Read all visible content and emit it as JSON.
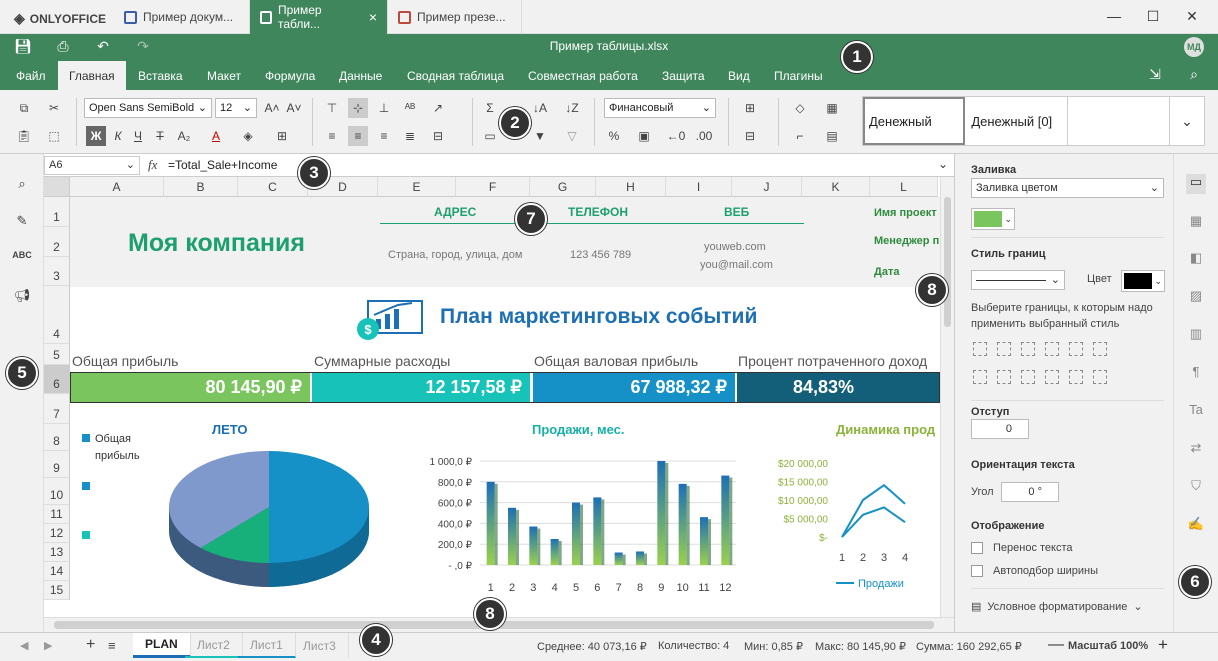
{
  "titlebar": {
    "logo": "ONLYOFFICE",
    "tabs": [
      {
        "label": "Пример докум...",
        "color": "#3a5da5"
      },
      {
        "label": "Пример табли...",
        "color": "#40865c"
      },
      {
        "label": "Пример презе...",
        "color": "#b94a3c"
      }
    ],
    "close_tab": "×",
    "minimize": "—",
    "maximize": "☐",
    "close": "✕"
  },
  "header": {
    "doc_title": "Пример таблицы.xlsx",
    "avatar": "МД",
    "menu": [
      "Файл",
      "Главная",
      "Вставка",
      "Макет",
      "Формула",
      "Данные",
      "Сводная таблица",
      "Совместная работа",
      "Защита",
      "Вид",
      "Плагины"
    ]
  },
  "toolbar": {
    "font_name": "Open Sans SemiBold",
    "font_size": "12",
    "number_format": "Финансовый",
    "styles": [
      "Денежный",
      "Денежный [0]",
      ""
    ]
  },
  "formula": {
    "cell_ref": "A6",
    "fx": "fx",
    "content": "=Total_Sale+Income"
  },
  "grid": {
    "columns": [
      "A",
      "B",
      "C",
      "D",
      "E",
      "F",
      "G",
      "H",
      "I",
      "J",
      "K",
      "L"
    ],
    "rows": [
      "1",
      "2",
      "3",
      "4",
      "5",
      "6",
      "7",
      "8",
      "9",
      "10",
      "11",
      "12",
      "13",
      "14",
      "15"
    ],
    "company": "Моя компания",
    "address_label": "АДРЕС",
    "phone_label": "ТЕЛЕФОН",
    "web_label": "ВЕБ",
    "address": "Страна, город, улица, дом",
    "phone": "123 456 789",
    "web1": "youweb.com",
    "web2": "you@mail.com",
    "project_name": "Имя проект",
    "manager": "Менеджер п",
    "date": "Дата",
    "plan_title": "План маркетинговых событий",
    "kpis": [
      {
        "label": "Общая прибыль",
        "value": "80 145,90 ₽",
        "color": "#7ac55e"
      },
      {
        "label": "Суммарные расходы",
        "value": "12 157,58 ₽",
        "color": "#17c2b8"
      },
      {
        "label": "Общая валовая прибыль",
        "value": "67 988,32 ₽",
        "color": "#1591c7"
      },
      {
        "label": "Процент потраченного доход",
        "value": "84,83%",
        "color": "#135e78"
      }
    ]
  },
  "chart_data": [
    {
      "type": "pie",
      "title": "ЛЕТО",
      "legend": [
        "Общая прибыль",
        "",
        ""
      ],
      "values": [
        50,
        12,
        38
      ],
      "colors": [
        "#1591c7",
        "#17b07a",
        "#7f99cc"
      ]
    },
    {
      "type": "bar",
      "title": "Продажи, мес.",
      "categories": [
        "1",
        "2",
        "3",
        "4",
        "5",
        "6",
        "7",
        "8",
        "9",
        "10",
        "11",
        "12"
      ],
      "values": [
        800,
        550,
        370,
        250,
        600,
        650,
        120,
        130,
        1000,
        780,
        460,
        860
      ],
      "yticks": [
        "1 000,0 ₽",
        "800,0 ₽",
        "600,0 ₽",
        "400,0 ₽",
        "200,0 ₽",
        "- ,0 ₽"
      ],
      "ylim": [
        0,
        1000
      ]
    },
    {
      "type": "line",
      "title": "Динамика прод",
      "categories": [
        "1",
        "2",
        "3",
        "4"
      ],
      "series": [
        {
          "name": "Продажи",
          "values": [
            0,
            10000,
            14000,
            9000
          ]
        },
        {
          "values": [
            0,
            6000,
            8000,
            4000
          ]
        }
      ],
      "yticks": [
        "$20 000,00",
        "$15 000,00",
        "$10 000,00",
        "$5 000,00",
        "$-"
      ],
      "ylim": [
        0,
        20000
      ]
    }
  ],
  "rightpanel": {
    "fill_label": "Заливка",
    "fill_type": "Заливка цветом",
    "fill_color": "#7ac55e",
    "border_style_label": "Стиль границ",
    "color_label": "Цвет",
    "border_hint": "Выберите границы, к которым надо применить выбранный стиль",
    "indent_label": "Отступ",
    "indent_value": "0",
    "orientation_label": "Ориентация текста",
    "angle_label": "Угол",
    "angle_value": "0 °",
    "display_label": "Отображение",
    "wrap_text": "Перенос текста",
    "autofit": "Автоподбор ширины",
    "cond_format": "Условное форматирование"
  },
  "statusbar": {
    "sheets": [
      "PLAN",
      "Лист2",
      "Лист1",
      "Лист3"
    ],
    "average": "Среднее: 40 073,16 ₽",
    "count": "Количество: 4",
    "min": "Мин: 0,85 ₽",
    "max": "Макс: 80 145,90 ₽",
    "sum": "Сумма: 160 292,65 ₽",
    "zoom": "Масштаб 100%"
  },
  "callouts": [
    "1",
    "2",
    "3",
    "4",
    "5",
    "6",
    "7",
    "8",
    "8"
  ]
}
